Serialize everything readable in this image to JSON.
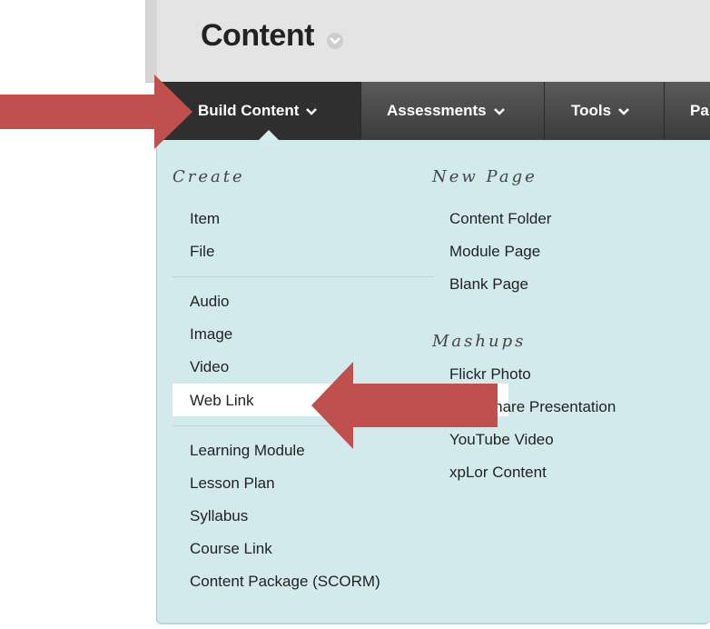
{
  "page": {
    "title": "Content"
  },
  "tabs": [
    {
      "label": "Build Content"
    },
    {
      "label": "Assessments"
    },
    {
      "label": "Tools"
    },
    {
      "label": "Pa"
    }
  ],
  "menu": {
    "create": {
      "heading": "Create",
      "items": [
        "Item",
        "File",
        "Audio",
        "Image",
        "Video",
        "Web Link",
        "Learning Module",
        "Lesson Plan",
        "Syllabus",
        "Course Link",
        "Content Package (SCORM)"
      ]
    },
    "new_page": {
      "heading": "New Page",
      "items": [
        "Content Folder",
        "Module Page",
        "Blank Page"
      ]
    },
    "mashups": {
      "heading": "Mashups",
      "items": [
        "Flickr Photo",
        "SlideShare Presentation",
        "YouTube Video",
        "xpLor Content"
      ]
    }
  },
  "colors": {
    "tab_bar": "#474747",
    "menu_background": "#d3eaed",
    "callout_arrow": "#c0504d"
  }
}
